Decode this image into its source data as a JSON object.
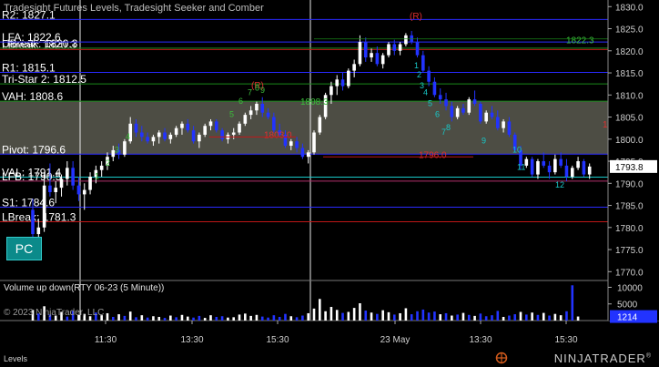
{
  "header": {
    "title": "Tradesight Futures Levels, Tradesight Seeker and Comber"
  },
  "subpanel": {
    "title": "Volume up down(RTY 06-23 (5 Minute))",
    "copyright": "© 2023 NinjaTrader, LLC"
  },
  "footer": {
    "tab_label": "Levels",
    "brand": "NINJATRADER",
    "brand_mark": "®"
  },
  "pc_button": {
    "label": "PC"
  },
  "colors": {
    "background": "#000000",
    "up": "#ffffff",
    "down": "#2233ff",
    "level_blue": "#2a2aff",
    "level_red": "#c01818",
    "level_green": "#1a8a1a",
    "vah_zone": "#5a5a50",
    "teal": "#18c8c8",
    "green_text": "#3cbf3c",
    "red_text": "#e03030"
  },
  "chart_data": {
    "type": "candlestick",
    "instrument": "RTY 06-23 (5 Minute)",
    "price_axis": {
      "ticks": [
        1830.0,
        1825.0,
        1820.0,
        1815.0,
        1810.0,
        1805.0,
        1800.0,
        1795.0,
        1790.0,
        1785.0,
        1780.0,
        1775.0,
        1770.0
      ],
      "range": [
        1768,
        1831.5
      ]
    },
    "time_axis": {
      "labels": [
        "11:30",
        "13:30",
        "15:30",
        "23 May",
        "13:30",
        "15:30"
      ]
    },
    "last_price": "1793.8",
    "session_break_label": "23 May",
    "levels": [
      {
        "label": "R2: 1827.1",
        "value": 1827.1,
        "color": "blue"
      },
      {
        "label": "LBreak: 1820.3",
        "value": 1820.3,
        "color": "red"
      },
      {
        "label": "UBreak: 1820.3",
        "value": 1820.6,
        "color": "green"
      },
      {
        "label": "LFA: 1822.6",
        "value": 1822.0,
        "color": "blue"
      },
      {
        "label": "R1: 1815.1",
        "value": 1815.1,
        "color": "blue"
      },
      {
        "label": "Tri-Star 2: 1812.5",
        "value": 1812.5,
        "color": "green"
      },
      {
        "label": "VAH: 1808.6",
        "value": 1808.6,
        "color": "green"
      },
      {
        "label": "Pivot: 1796.6",
        "value": 1796.6,
        "color": "blue"
      },
      {
        "label": "VAL: 1791.4",
        "value": 1791.4,
        "color": "teal"
      },
      {
        "label": "LFB: 1790.5",
        "value": 1790.5,
        "color": "magenta"
      },
      {
        "label": "S1: 1784.6",
        "value": 1784.6,
        "color": "blue"
      },
      {
        "label": "LBreak: 1781.3",
        "value": 1781.3,
        "color": "red"
      }
    ],
    "value_area": {
      "high": 1808.6,
      "low": 1796.6
    },
    "annotations": [
      {
        "text": "1822.3",
        "value": 1822.3,
        "color": "green"
      },
      {
        "text": "1803.0",
        "value": 1800.9,
        "color": "red"
      },
      {
        "text": "1796.0",
        "value": 1796.3,
        "color": "red"
      },
      {
        "text": "1808.3",
        "value": 1808.4,
        "color": "green"
      },
      {
        "text": "1",
        "value": 1803.3,
        "color": "red"
      },
      {
        "text": "(R)",
        "value": 1812.1,
        "color": "red"
      },
      {
        "text": "(R)",
        "value": 1827.8,
        "color": "red"
      }
    ],
    "seeker_counts_up": [
      "1",
      "2",
      "3",
      "4",
      "5",
      "6",
      "7",
      "8",
      "9"
    ],
    "seeker_counts_down": [
      "1",
      "2",
      "3",
      "4",
      "5",
      "6",
      "7",
      "8",
      "9",
      "10",
      "11",
      "12"
    ],
    "volume_axis": {
      "ticks": [
        10000,
        5000
      ],
      "last": "1214",
      "range": [
        0,
        11500
      ]
    },
    "candles": [
      [
        1784.0,
        1786.5,
        1777.0,
        1778.5
      ],
      [
        1778.5,
        1782.0,
        1776.0,
        1780.0
      ],
      [
        1780.0,
        1792.0,
        1779.0,
        1789.5
      ],
      [
        1789.5,
        1794.5,
        1787.0,
        1788.0
      ],
      [
        1788.0,
        1790.5,
        1785.5,
        1789.0
      ],
      [
        1789.0,
        1792.0,
        1787.0,
        1791.0
      ],
      [
        1791.0,
        1795.0,
        1789.5,
        1793.5
      ],
      [
        1793.5,
        1795.0,
        1788.5,
        1789.5
      ],
      [
        1789.5,
        1791.5,
        1786.0,
        1787.5
      ],
      [
        1787.5,
        1790.0,
        1784.0,
        1788.5
      ],
      [
        1788.5,
        1792.5,
        1787.5,
        1791.5
      ],
      [
        1791.5,
        1794.0,
        1790.0,
        1793.0
      ],
      [
        1793.0,
        1795.0,
        1791.5,
        1794.0
      ],
      [
        1794.0,
        1797.0,
        1793.0,
        1796.0
      ],
      [
        1796.0,
        1798.5,
        1795.0,
        1797.5
      ],
      [
        1797.5,
        1799.0,
        1795.5,
        1796.5
      ],
      [
        1796.5,
        1800.0,
        1796.0,
        1799.5
      ],
      [
        1799.5,
        1805.0,
        1799.0,
        1803.5
      ],
      [
        1803.5,
        1804.5,
        1800.5,
        1801.5
      ],
      [
        1801.5,
        1803.0,
        1799.5,
        1800.5
      ],
      [
        1800.5,
        1801.5,
        1799.0,
        1799.5
      ],
      [
        1799.5,
        1801.0,
        1798.5,
        1800.5
      ],
      [
        1800.5,
        1802.0,
        1799.0,
        1801.5
      ],
      [
        1801.5,
        1802.5,
        1799.5,
        1800.0
      ],
      [
        1800.0,
        1801.5,
        1799.0,
        1801.0
      ],
      [
        1801.0,
        1803.0,
        1800.5,
        1802.5
      ],
      [
        1802.5,
        1804.0,
        1801.0,
        1803.5
      ],
      [
        1803.5,
        1804.5,
        1801.5,
        1802.0
      ],
      [
        1802.0,
        1803.0,
        1799.0,
        1799.5
      ],
      [
        1799.5,
        1801.5,
        1798.0,
        1801.0
      ],
      [
        1801.0,
        1803.5,
        1800.5,
        1803.0
      ],
      [
        1803.0,
        1804.5,
        1802.0,
        1804.0
      ],
      [
        1804.0,
        1804.5,
        1801.5,
        1802.0
      ],
      [
        1802.0,
        1802.5,
        1799.5,
        1800.0
      ],
      [
        1800.0,
        1801.5,
        1799.0,
        1801.0
      ],
      [
        1801.0,
        1802.5,
        1800.0,
        1801.5
      ],
      [
        1801.5,
        1804.0,
        1801.0,
        1803.5
      ],
      [
        1803.5,
        1806.0,
        1803.0,
        1805.5
      ],
      [
        1805.5,
        1807.5,
        1804.5,
        1806.5
      ],
      [
        1806.5,
        1808.5,
        1805.5,
        1808.0
      ],
      [
        1808.0,
        1809.5,
        1805.0,
        1806.0
      ],
      [
        1806.0,
        1807.0,
        1804.5,
        1805.0
      ],
      [
        1805.0,
        1806.0,
        1801.5,
        1802.0
      ],
      [
        1802.0,
        1803.5,
        1800.5,
        1801.0
      ],
      [
        1801.0,
        1802.0,
        1798.0,
        1798.5
      ],
      [
        1798.5,
        1800.0,
        1797.5,
        1799.5
      ],
      [
        1799.5,
        1800.5,
        1797.0,
        1798.0
      ],
      [
        1798.0,
        1799.0,
        1795.5,
        1796.0
      ],
      [
        1796.0,
        1797.5,
        1794.5,
        1797.0
      ],
      [
        1797.0,
        1802.0,
        1796.5,
        1801.5
      ],
      [
        1801.5,
        1805.5,
        1801.0,
        1805.0
      ],
      [
        1805.0,
        1810.5,
        1804.5,
        1810.0
      ],
      [
        1810.0,
        1813.0,
        1808.0,
        1812.0
      ],
      [
        1812.0,
        1814.5,
        1810.0,
        1813.5
      ],
      [
        1813.5,
        1815.0,
        1811.0,
        1812.0
      ],
      [
        1812.0,
        1816.0,
        1811.5,
        1815.5
      ],
      [
        1815.5,
        1818.0,
        1814.0,
        1817.0
      ],
      [
        1817.0,
        1823.5,
        1816.5,
        1822.0
      ],
      [
        1822.0,
        1823.0,
        1817.5,
        1818.5
      ],
      [
        1818.5,
        1820.5,
        1817.5,
        1819.5
      ],
      [
        1819.5,
        1821.0,
        1816.5,
        1817.0
      ],
      [
        1817.0,
        1819.5,
        1816.0,
        1819.0
      ],
      [
        1819.0,
        1822.0,
        1818.5,
        1821.5
      ],
      [
        1821.5,
        1822.5,
        1819.0,
        1820.0
      ],
      [
        1820.0,
        1822.0,
        1819.0,
        1821.5
      ],
      [
        1821.5,
        1824.0,
        1821.0,
        1823.5
      ],
      [
        1823.5,
        1824.5,
        1821.5,
        1822.0
      ],
      [
        1822.0,
        1823.0,
        1818.5,
        1819.0
      ],
      [
        1819.0,
        1820.0,
        1815.0,
        1815.5
      ],
      [
        1815.5,
        1816.5,
        1812.0,
        1813.0
      ],
      [
        1813.0,
        1814.0,
        1809.5,
        1810.0
      ],
      [
        1810.0,
        1811.5,
        1808.0,
        1809.0
      ],
      [
        1809.0,
        1810.5,
        1806.5,
        1807.5
      ],
      [
        1807.5,
        1808.5,
        1804.0,
        1805.0
      ],
      [
        1805.0,
        1807.5,
        1804.5,
        1807.0
      ],
      [
        1807.0,
        1808.0,
        1805.5,
        1806.0
      ],
      [
        1806.0,
        1809.5,
        1805.5,
        1809.0
      ],
      [
        1809.0,
        1811.0,
        1807.5,
        1808.0
      ],
      [
        1808.0,
        1808.5,
        1803.5,
        1804.0
      ],
      [
        1804.0,
        1806.5,
        1803.5,
        1806.0
      ],
      [
        1806.0,
        1807.5,
        1804.5,
        1805.0
      ],
      [
        1805.0,
        1806.5,
        1802.0,
        1802.5
      ],
      [
        1802.5,
        1804.5,
        1801.5,
        1804.0
      ],
      [
        1804.0,
        1805.0,
        1800.5,
        1801.0
      ],
      [
        1801.0,
        1801.5,
        1797.0,
        1797.5
      ],
      [
        1797.5,
        1798.5,
        1793.0,
        1794.0
      ],
      [
        1794.0,
        1796.0,
        1793.5,
        1795.5
      ],
      [
        1795.5,
        1796.0,
        1791.5,
        1792.0
      ],
      [
        1792.0,
        1795.5,
        1791.0,
        1795.0
      ],
      [
        1795.0,
        1797.0,
        1793.5,
        1794.0
      ],
      [
        1794.0,
        1795.0,
        1791.0,
        1792.5
      ],
      [
        1792.5,
        1796.5,
        1792.0,
        1795.5
      ],
      [
        1795.5,
        1797.0,
        1793.5,
        1794.0
      ],
      [
        1794.0,
        1795.5,
        1790.5,
        1791.5
      ],
      [
        1791.5,
        1794.0,
        1791.0,
        1793.5
      ],
      [
        1793.5,
        1796.0,
        1793.0,
        1795.0
      ],
      [
        1795.0,
        1795.5,
        1791.5,
        1792.0
      ],
      [
        1792.0,
        1794.5,
        1791.0,
        1793.8
      ]
    ],
    "volumes": [
      [
        3200,
        1
      ],
      [
        2100,
        0
      ],
      [
        4300,
        1
      ],
      [
        1800,
        0
      ],
      [
        1500,
        1
      ],
      [
        2600,
        1
      ],
      [
        1200,
        0
      ],
      [
        2900,
        0
      ],
      [
        1700,
        1
      ],
      [
        2000,
        1
      ],
      [
        1300,
        1
      ],
      [
        2400,
        0
      ],
      [
        1600,
        1
      ],
      [
        2200,
        1
      ],
      [
        1100,
        0
      ],
      [
        1900,
        1
      ],
      [
        1400,
        0
      ],
      [
        2700,
        1
      ],
      [
        1000,
        0
      ],
      [
        1600,
        1
      ],
      [
        900,
        0
      ],
      [
        1300,
        1
      ],
      [
        1100,
        1
      ],
      [
        800,
        0
      ],
      [
        1500,
        1
      ],
      [
        1000,
        0
      ],
      [
        1700,
        1
      ],
      [
        1200,
        1
      ],
      [
        900,
        0
      ],
      [
        1400,
        0
      ],
      [
        800,
        1
      ],
      [
        1600,
        1
      ],
      [
        1100,
        0
      ],
      [
        1300,
        0
      ],
      [
        900,
        1
      ],
      [
        1000,
        1
      ],
      [
        1800,
        1
      ],
      [
        2100,
        1
      ],
      [
        1400,
        1
      ],
      [
        1700,
        1
      ],
      [
        1200,
        0
      ],
      [
        900,
        0
      ],
      [
        1600,
        0
      ],
      [
        1100,
        0
      ],
      [
        2000,
        0
      ],
      [
        1300,
        1
      ],
      [
        1000,
        0
      ],
      [
        1500,
        0
      ],
      [
        2200,
        1
      ],
      [
        3600,
        1
      ],
      [
        6500,
        1
      ],
      [
        2800,
        1
      ],
      [
        4100,
        1
      ],
      [
        3200,
        1
      ],
      [
        2300,
        0
      ],
      [
        2600,
        1
      ],
      [
        3800,
        1
      ],
      [
        5200,
        1
      ],
      [
        3000,
        0
      ],
      [
        2400,
        1
      ],
      [
        2000,
        0
      ],
      [
        3100,
        1
      ],
      [
        2500,
        1
      ],
      [
        1800,
        0
      ],
      [
        2200,
        1
      ],
      [
        3700,
        1
      ],
      [
        1900,
        0
      ],
      [
        2800,
        0
      ],
      [
        3300,
        0
      ],
      [
        2400,
        0
      ],
      [
        2700,
        0
      ],
      [
        1900,
        1
      ],
      [
        2200,
        0
      ],
      [
        1500,
        1
      ],
      [
        1800,
        0
      ],
      [
        2300,
        1
      ],
      [
        1700,
        0
      ],
      [
        1400,
        1
      ],
      [
        2100,
        0
      ],
      [
        1300,
        0
      ],
      [
        1600,
        0
      ],
      [
        2900,
        0
      ],
      [
        1100,
        1
      ],
      [
        1500,
        0
      ],
      [
        1900,
        0
      ],
      [
        2600,
        1
      ],
      [
        1800,
        0
      ],
      [
        2400,
        1
      ],
      [
        1700,
        0
      ],
      [
        2300,
        1
      ],
      [
        1500,
        0
      ],
      [
        2000,
        1
      ],
      [
        1600,
        1
      ],
      [
        2800,
        0
      ],
      [
        10600,
        0
      ],
      [
        1214,
        1
      ]
    ]
  }
}
